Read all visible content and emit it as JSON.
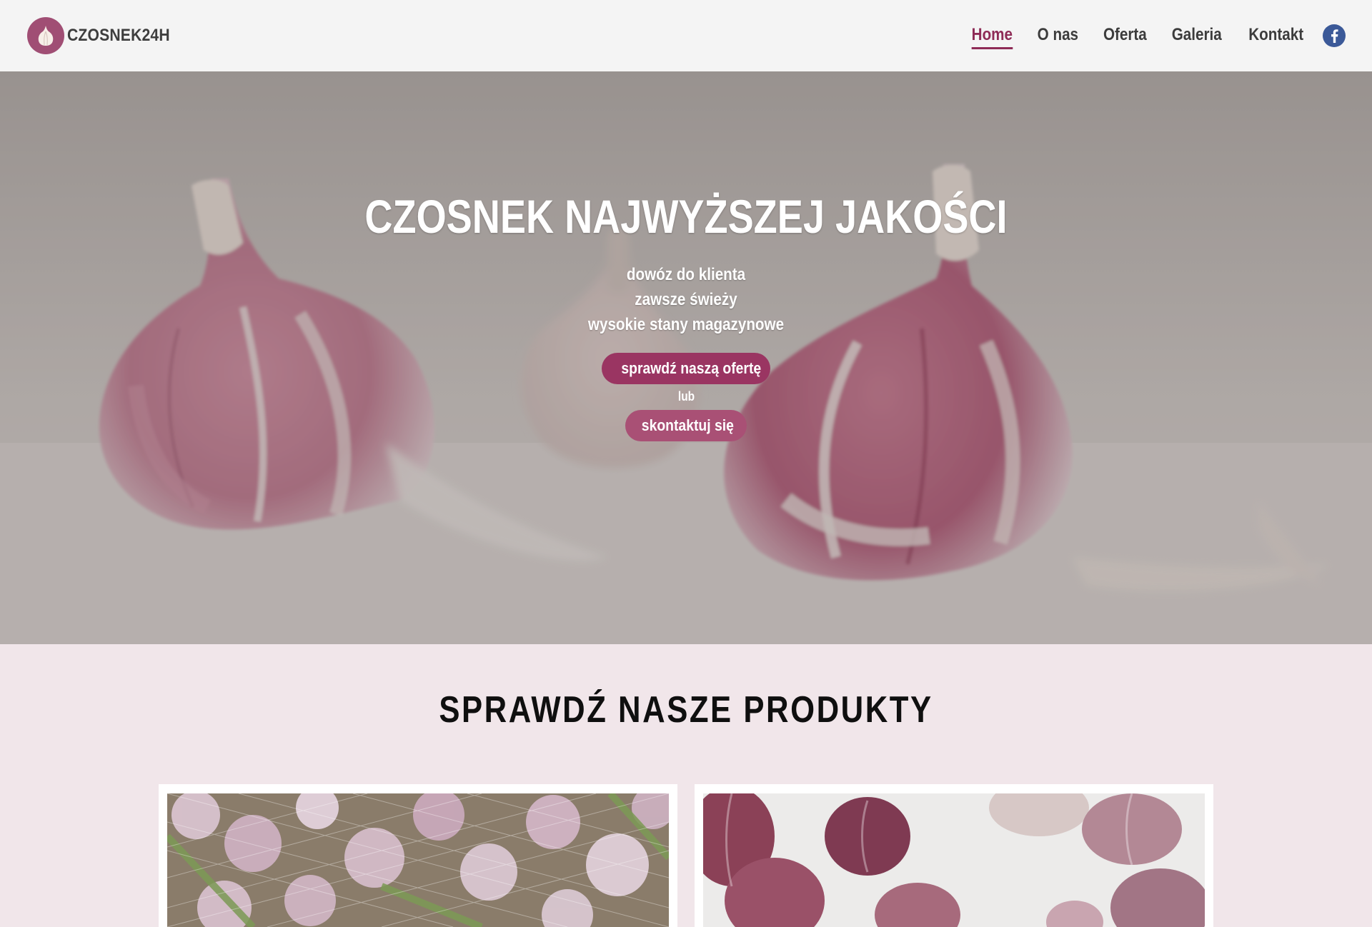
{
  "header": {
    "brand_name": "CZOSNEK24H",
    "logo_icon": "garlic-icon",
    "nav": [
      {
        "label": "Home",
        "active": true
      },
      {
        "label": "O nas",
        "active": false
      },
      {
        "label": "Oferta",
        "active": false
      },
      {
        "label": "Galeria",
        "active": false
      },
      {
        "label": "Kontakt",
        "active": false
      }
    ],
    "social_icon": "facebook-icon"
  },
  "hero": {
    "title": "CZOSNEK NAJWYŻSZEJ JAKOŚCI",
    "lines": [
      "dowóz do klienta",
      "zawsze świeży",
      "wysokie stany magazynowe"
    ],
    "primary_button": "sprawdź naszą ofertę",
    "or_text": "lub",
    "secondary_button": "skontaktuj się"
  },
  "products": {
    "title": "SPRAWDŹ NASZE PRODUKTY"
  },
  "colors": {
    "accent": "#8e2b56",
    "button_primary": "#9a3562",
    "button_secondary": "#a95075",
    "section_bg": "#f1e6ea",
    "header_bg": "#f4f4f4",
    "facebook": "#3b5998"
  }
}
